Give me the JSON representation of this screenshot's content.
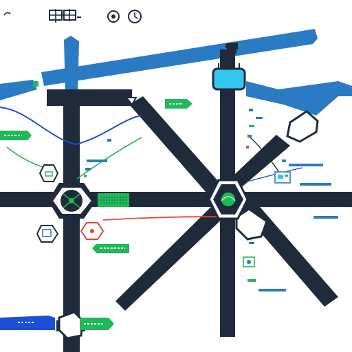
{
  "palette": {
    "navy": "#1f2a3a",
    "blue": "#2a7bc4",
    "deep_blue": "#1c4fd6",
    "cyan": "#33c6ee",
    "green": "#1fb85a",
    "red": "#e4472b",
    "white": "#ffffff"
  },
  "icons": [
    "toolbar-grid-icon",
    "record-icon",
    "clock-icon",
    "compass-hub-icon",
    "radar-hub-icon",
    "shield-node-icon",
    "monitor-node-icon"
  ]
}
